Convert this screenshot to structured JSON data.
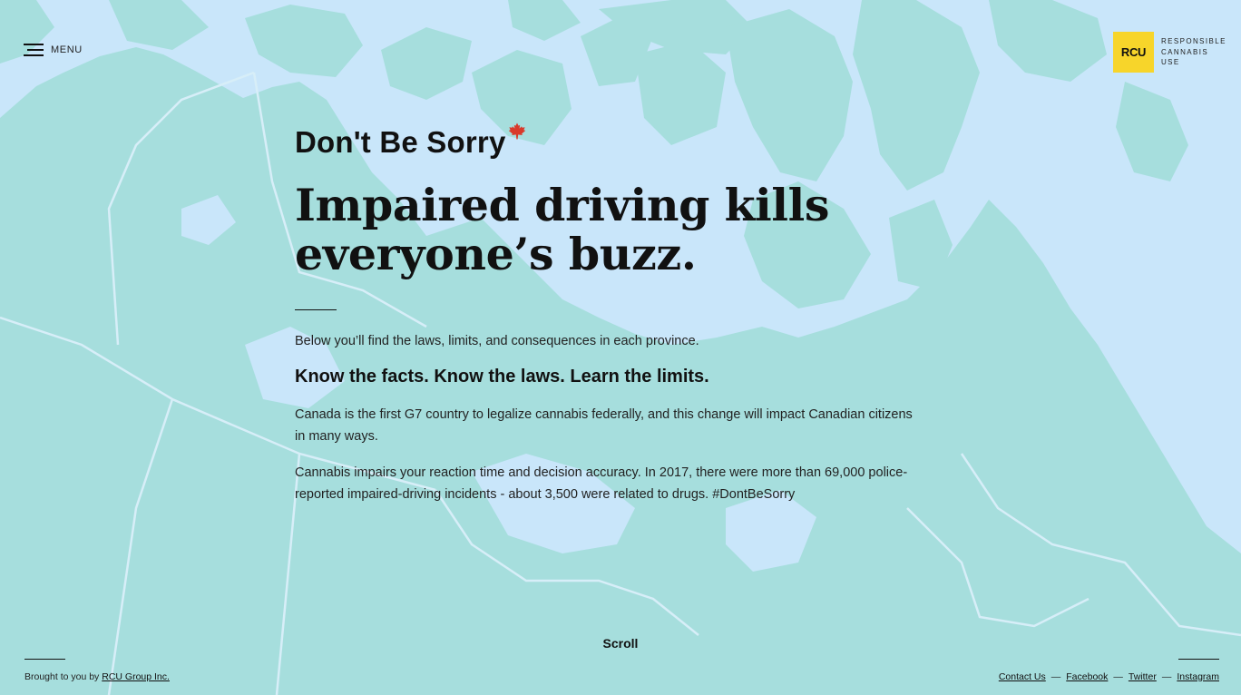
{
  "menu": {
    "label": "MENU"
  },
  "logo": {
    "mark": "RCU",
    "line1": "RESPONSIBLE",
    "line2": "CANNABIS",
    "line3": "USE"
  },
  "hero": {
    "eyebrow": "Don't Be Sorry",
    "headline_line1": "Impaired driving kills",
    "headline_line2": "everyone’s buzz.",
    "intro": "Below you’ll find the laws, limits, and consequences in each province.",
    "subhead": "Know the facts. Know the laws. Learn the limits.",
    "para1": "Canada is the first G7 country to legalize cannabis federally, and this change will impact Canadian citizens in many ways.",
    "para2": "Cannabis impairs your reaction time and decision accuracy. In 2017, there were more than 69,000 police-reported impaired-driving incidents - about 3,500 were related to drugs. #DontBeSorry"
  },
  "scroll": {
    "label": "Scroll"
  },
  "footer": {
    "credit_prefix": "Brought to you by",
    "credit_link": "RCU Group Inc.",
    "links": [
      "Contact Us",
      "Facebook",
      "Twitter",
      "Instagram"
    ],
    "separator": "—"
  },
  "icons": {
    "menu": "hamburger-icon",
    "leaf": "maple-leaf-icon"
  },
  "colors": {
    "water": "#c9e6fa",
    "land": "#a6dedd",
    "accent": "#f7d52a",
    "leaf": "#d93a2b"
  }
}
